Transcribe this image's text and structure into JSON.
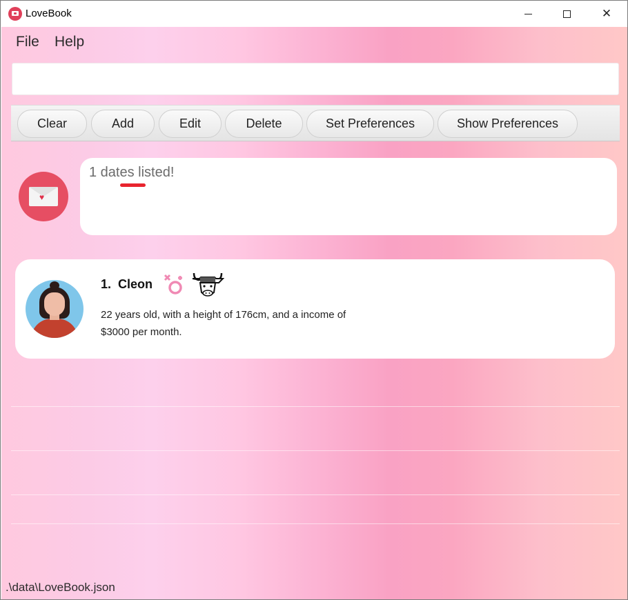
{
  "window": {
    "title": "LoveBook",
    "controls": {
      "minimize": "minimize",
      "maximize": "maximize",
      "close": "✕"
    }
  },
  "menu": {
    "items": [
      {
        "label": "File"
      },
      {
        "label": "Help"
      }
    ]
  },
  "command_box": {
    "value": "",
    "placeholder": ""
  },
  "toolbar": {
    "buttons": [
      {
        "label": "Clear"
      },
      {
        "label": "Add"
      },
      {
        "label": "Edit"
      },
      {
        "label": "Delete"
      },
      {
        "label": "Set Preferences"
      },
      {
        "label": "Show Preferences"
      }
    ]
  },
  "result": {
    "message": "1 dates listed!",
    "icon": "envelope-heart-icon",
    "annotation_color": "#e8242e"
  },
  "dates": [
    {
      "index": "1.",
      "name": "Cleon",
      "gender_icon": "gender-symbol-icon",
      "zodiac_icon": "ox-icon",
      "description": "22 years old, with a height of 176cm, and a income of $3000 per month."
    }
  ],
  "status_bar": {
    "path": ".\\data\\LoveBook.json"
  },
  "colors": {
    "accent": "#e64e63",
    "gender_icon": "#f08ab4"
  }
}
